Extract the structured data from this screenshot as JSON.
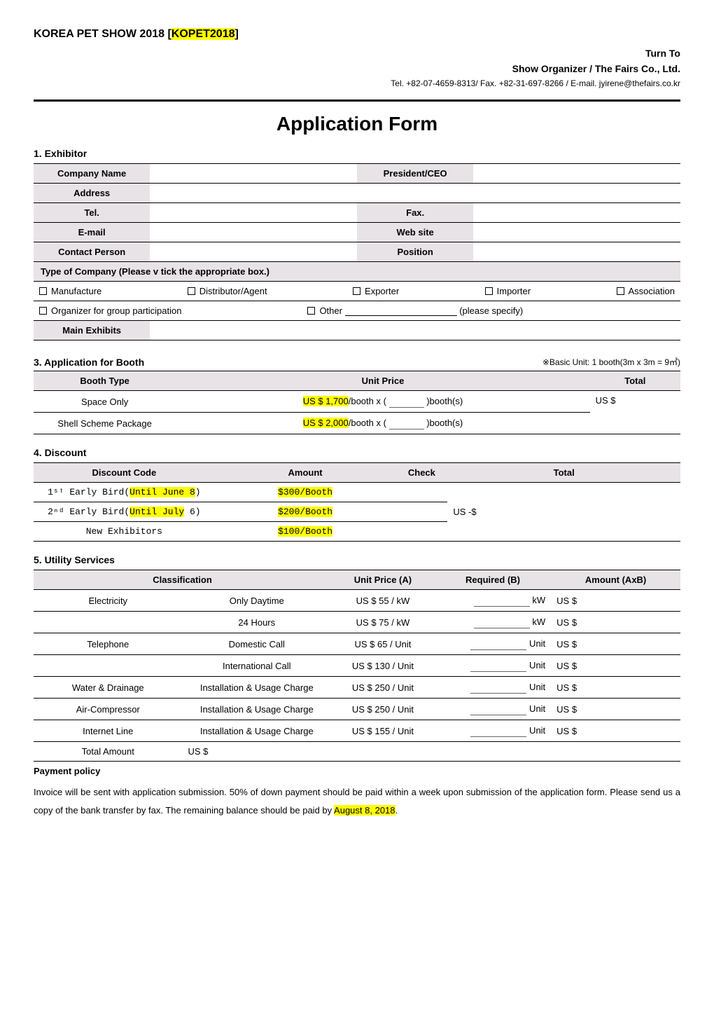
{
  "header": {
    "show_title_prefix": "KOREA PET SHOW 2018 [",
    "show_title_highlight": "KOPET2018",
    "show_title_suffix": "]",
    "turn_to": "Turn To",
    "organizer": "Show Organizer / The Fairs Co., Ltd.",
    "contact": "Tel. +82-07-4659-8313/ Fax. +82-31-697-8266 / E-mail. jyirene@thefairs.co.kr"
  },
  "form_title": "Application Form",
  "s1": {
    "heading": "1. Exhibitor",
    "labels": {
      "company_name": "Company Name",
      "president": "President/CEO",
      "address": "Address",
      "tel": "Tel.",
      "fax": "Fax.",
      "email": "E-mail",
      "website": "Web site",
      "contact_person": "Contact Person",
      "position": "Position",
      "type_header": "Type of Company (Please v tick the appropriate box.)",
      "main_exhibits": "Main Exhibits"
    },
    "types": {
      "manufacture": "Manufacture",
      "distributor": "Distributor/Agent",
      "exporter": "Exporter",
      "importer": "Importer",
      "association": "Association",
      "organizer_group": "Organizer for group participation",
      "other": "Other",
      "please_specify": "(please specify)"
    }
  },
  "s3": {
    "heading": "3. Application for Booth",
    "note": "※Basic Unit: 1 booth(3m x 3m = 9㎡)",
    "headers": {
      "booth_type": "Booth Type",
      "unit_price": "Unit Price",
      "total": "Total"
    },
    "rows": {
      "space_only": {
        "label": "Space Only",
        "price_hl": "US $ 1,700",
        "price_suffix_a": "/booth x (",
        "price_suffix_b": ")booth(s)"
      },
      "shell": {
        "label": "Shell Scheme Package",
        "price_hl": "US $ 2,000",
        "price_suffix_a": "/booth x (",
        "price_suffix_b": ")booth(s)"
      }
    },
    "total_prefix": "US $"
  },
  "s4": {
    "heading": "4. Discount",
    "headers": {
      "code": "Discount Code",
      "amount": "Amount",
      "check": "Check",
      "total": "Total"
    },
    "rows": {
      "eb1": {
        "label_a": "1ˢᵗ Early Bird(",
        "label_hl": "Until June 8",
        "label_b": ")",
        "amount": "$300/Booth"
      },
      "eb2": {
        "label_a": "2ⁿᵈ Early Bird(",
        "label_hl": "Until July",
        "label_b": " 6)",
        "amount": "$200/Booth"
      },
      "new": {
        "label": "New Exhibitors",
        "amount": "$100/Booth"
      }
    },
    "total_prefix": "US -$"
  },
  "s5": {
    "heading": "5. Utility Services",
    "headers": {
      "classification": "Classification",
      "unit_price": "Unit Price (A)",
      "required": "Required (B)",
      "amount": "Amount (AxB)"
    },
    "rows": [
      {
        "cat": "Electricity",
        "sub": "Only Daytime",
        "price": "US $ 55 / kW",
        "req_unit": "kW"
      },
      {
        "cat": "",
        "sub": "24 Hours",
        "price": "US $ 75 / kW",
        "req_unit": "kW"
      },
      {
        "cat": "Telephone",
        "sub": "Domestic Call",
        "price": "US $ 65 / Unit",
        "req_unit": "Unit"
      },
      {
        "cat": "",
        "sub": "International Call",
        "price": "US $ 130 / Unit",
        "req_unit": "Unit"
      },
      {
        "cat": "Water & Drainage",
        "sub": "Installation & Usage Charge",
        "price": "US $ 250 / Unit",
        "req_unit": "Unit"
      },
      {
        "cat": "Air-Compressor",
        "sub": "Installation & Usage Charge",
        "price": "US $ 250 / Unit",
        "req_unit": "Unit"
      },
      {
        "cat": "Internet Line",
        "sub": "Installation & Usage Charge",
        "price": "US $ 155 / Unit",
        "req_unit": "Unit"
      }
    ],
    "total_label": "Total Amount",
    "amount_prefix": "US $"
  },
  "payment": {
    "heading": "Payment policy",
    "body_a": "Invoice will be sent with application submission. 50% of down payment should be paid within a week upon submission of the application form. Please send us a copy of the bank transfer by fax. The remaining balance should be paid by ",
    "body_hl": "August 8, 2018",
    "body_b": "."
  }
}
